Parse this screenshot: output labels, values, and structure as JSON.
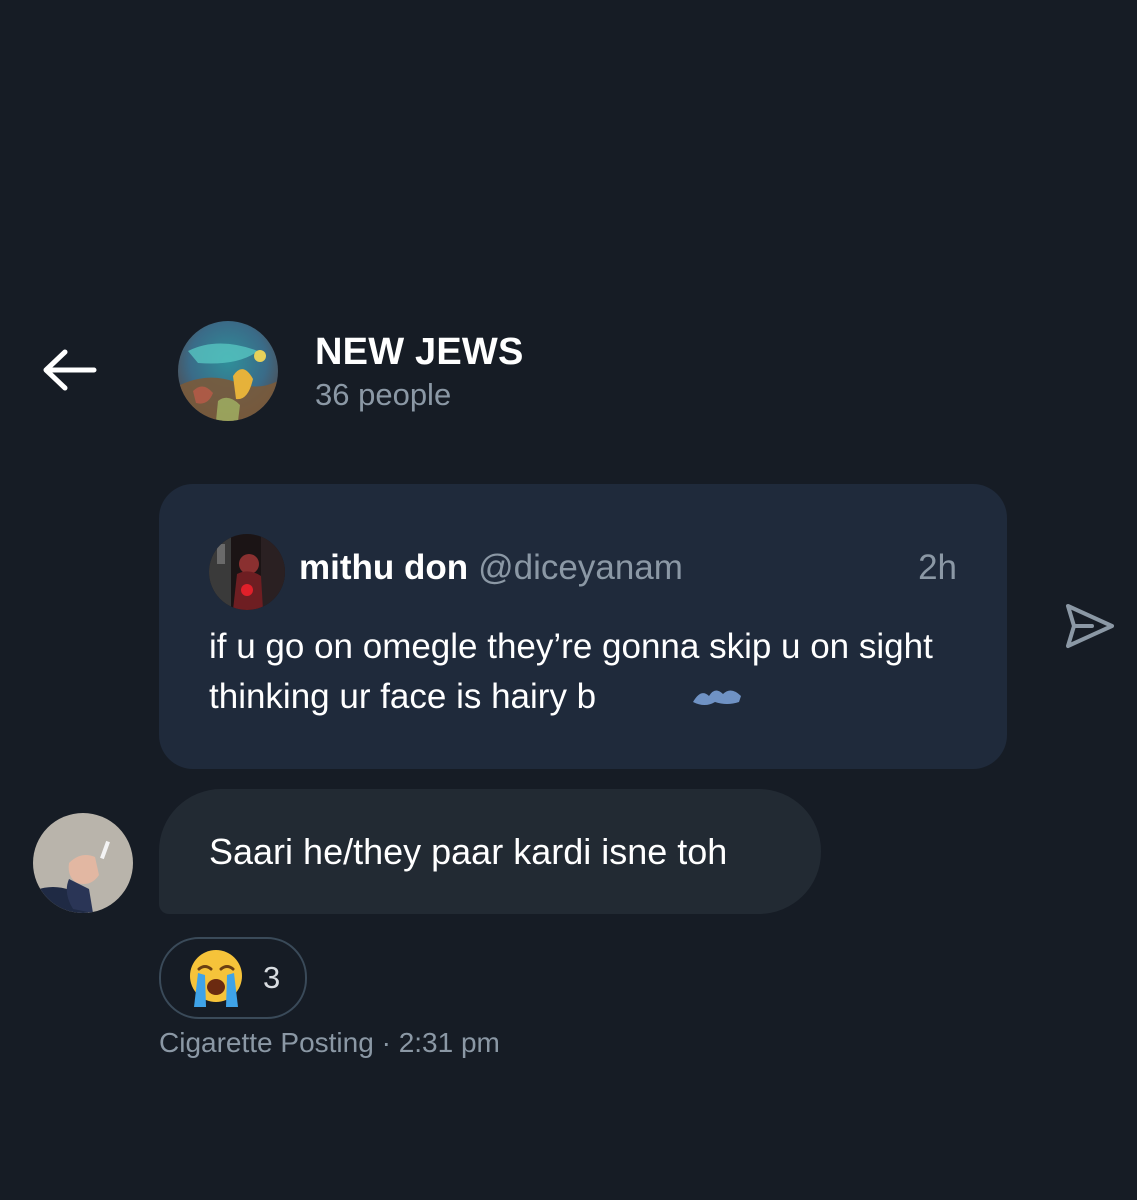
{
  "header": {
    "back_icon": "arrow-left-icon",
    "group_name": "NEW JEWS",
    "member_count": "36 people"
  },
  "quoted_post": {
    "author_name": "mithu don",
    "author_handle": "@diceyanam",
    "time": "2h",
    "text": "if u go on omegle they’re gonna skip u on sight thinking ur face is hairy b"
  },
  "share_icon": "send-icon",
  "message": {
    "text": "Saari he/they paar kardi isne toh",
    "reaction": {
      "emoji": "😭",
      "count": "3"
    },
    "sender": "Cigarette Posting",
    "separator": "·",
    "time": "2:31 pm"
  },
  "colors": {
    "background": "#161c25",
    "quote_card": "#1f2a3b",
    "bubble": "#222a33",
    "muted_text": "#8b98a5",
    "scribble": "#6f92c4"
  }
}
